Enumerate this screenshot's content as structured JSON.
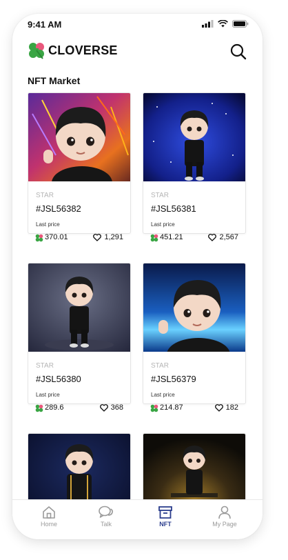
{
  "status": {
    "time": "9:41 AM"
  },
  "app": {
    "name": "CLOVERSE"
  },
  "section": {
    "title": "NFT Market"
  },
  "cards": [
    {
      "category": "STAR",
      "id": "#JSL56382",
      "last_price_label": "Last price",
      "price": "370.01",
      "likes": "1,291"
    },
    {
      "category": "STAR",
      "id": "#JSL56381",
      "last_price_label": "Last price",
      "price": "451.21",
      "likes": "2,567"
    },
    {
      "category": "STAR",
      "id": "#JSL56380",
      "last_price_label": "Last price",
      "price": "289.6",
      "likes": "368"
    },
    {
      "category": "STAR",
      "id": "#JSL56379",
      "last_price_label": "Last price",
      "price": "214.87",
      "likes": "182"
    }
  ],
  "tabs": [
    {
      "label": "Home",
      "icon": "home-icon"
    },
    {
      "label": "Talk",
      "icon": "chat-icon"
    },
    {
      "label": "NFT",
      "icon": "archive-box-icon"
    },
    {
      "label": "My Page",
      "icon": "person-icon"
    }
  ],
  "colors": {
    "accent": "#2a3c8c",
    "clover_green": "#3aa544",
    "clover_pink": "#e9577c"
  }
}
